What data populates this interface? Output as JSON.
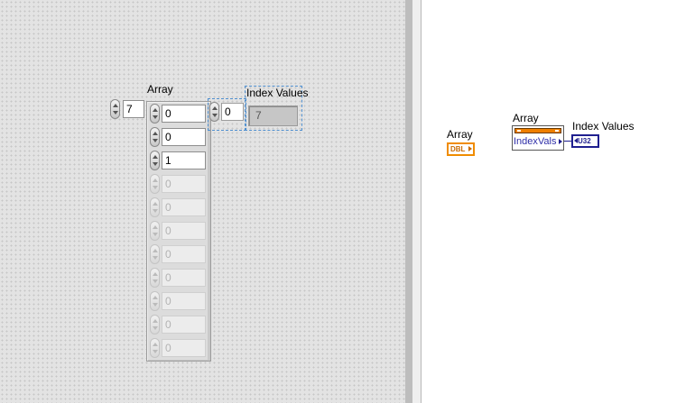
{
  "front_panel": {
    "array_label": "Array",
    "array_index": "7",
    "elements": [
      "0",
      "0",
      "1",
      "0",
      "0",
      "0",
      "0",
      "0",
      "0",
      "0",
      "0"
    ],
    "active_count": 3,
    "index_values_label": "Index Values",
    "index_values_index": "0",
    "index_values_value": "7"
  },
  "block_diagram": {
    "array_terminal_label": "Array",
    "array_terminal_type": "DBL",
    "index_node_label": "Array",
    "index_node_output": "IndexVals",
    "index_values_terminal_label": "Index Values",
    "index_values_terminal_type": "U32"
  },
  "colors": {
    "dbl_orange": "#f08c00",
    "u32_blue": "#1f1f8f",
    "selection_blue": "#4f8fcf"
  }
}
